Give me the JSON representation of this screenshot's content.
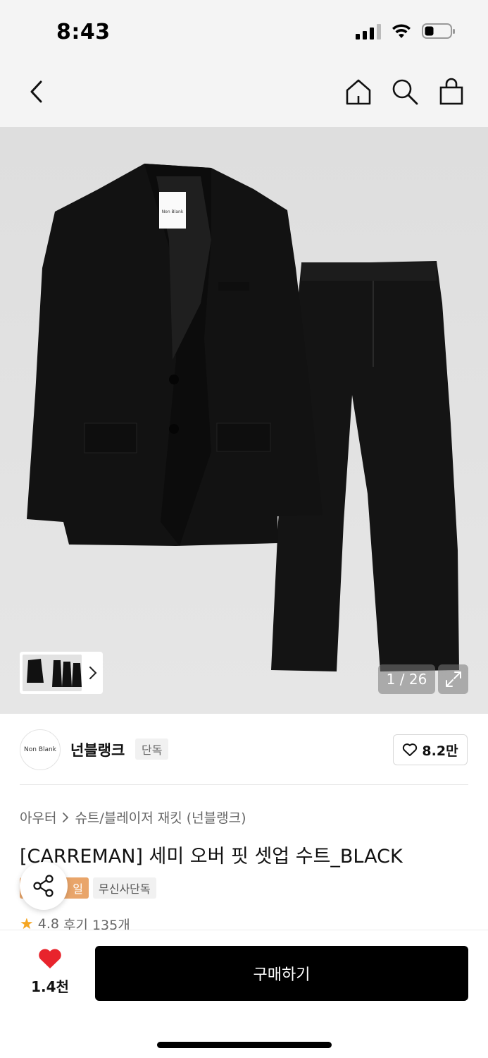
{
  "status_bar": {
    "time": "8:43"
  },
  "nav": {
    "icons": [
      "back-icon",
      "home-icon",
      "search-icon",
      "shopping-bag-icon"
    ]
  },
  "gallery": {
    "counter": "1 / 26",
    "tag_label": "Non Blank"
  },
  "brand": {
    "logo_text": "Non Blank",
    "name": "넌블랭크",
    "badge": "단독",
    "likes": "8.2만"
  },
  "breadcrumb": {
    "level1": "아우터",
    "level2": "슈트/블레이저 재킷 (넌블랭크)"
  },
  "product": {
    "title": "[CARREMAN] 세미 오버 핏 셋업 수트_BLACK",
    "tags": [
      "일",
      "무신사단독"
    ],
    "rating": "4.8",
    "reviews": "후기 135개"
  },
  "bottom_bar": {
    "favorites": "1.4천",
    "buy_label": "구매하기"
  },
  "colors": {
    "accent_sale": "#e9a56a",
    "heart_red": "#e8242c",
    "button_black": "#000000",
    "star": "#f5a623"
  }
}
